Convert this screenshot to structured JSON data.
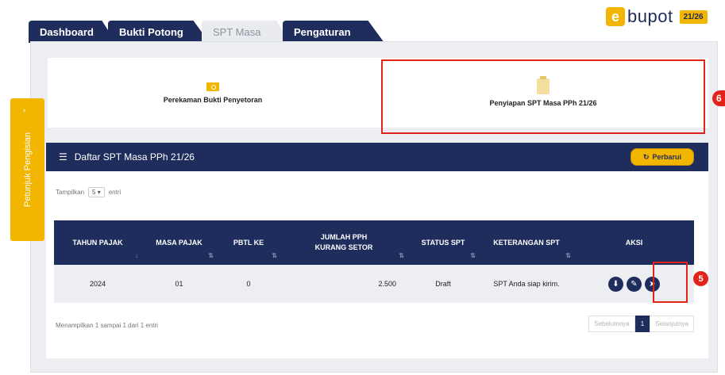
{
  "nav": {
    "tabs": [
      {
        "label": "Dashboard"
      },
      {
        "label": "Bukti Potong"
      },
      {
        "label": "SPT Masa"
      },
      {
        "label": "Pengaturan"
      }
    ]
  },
  "logo": {
    "mark": "e",
    "text": "bupot",
    "badge": "21/26"
  },
  "side_tab": {
    "label": "Petunjuk Pengisian",
    "chevron": "›"
  },
  "cards": [
    {
      "title": "Perekaman Bukti Penyetoran",
      "icon": "folder-icon"
    },
    {
      "title": "Penyiapan SPT Masa PPh 21/26",
      "icon": "clipboard-icon"
    }
  ],
  "markers": {
    "card_marker": "6",
    "action_marker": "5"
  },
  "list": {
    "title": "Daftar SPT Masa PPh 21/26",
    "refresh_label": "Perbarui",
    "show_prefix": "Tampilkan",
    "show_value": "5",
    "show_suffix": "entri",
    "columns": [
      "TAHUN PAJAK",
      "MASA PAJAK",
      "PBTL KE",
      "JUMLAH PPH KURANG SETOR",
      "STATUS SPT",
      "KETERANGAN SPT",
      "AKSI"
    ],
    "rows": [
      {
        "tahun": "2024",
        "masa": "01",
        "pbtl": "0",
        "jumlah": "2.500",
        "status": "Draft",
        "keterangan": "SPT Anda siap kirim."
      }
    ],
    "footer": "Menampilkan 1 sampai 1 dari 1 entri",
    "pager": {
      "prev": "Sebelumnya",
      "current": "1",
      "next": "Selanjutnya"
    }
  },
  "colors": {
    "navy": "#1f2d5c",
    "accent": "#f2b500",
    "highlight": "#e2231a"
  }
}
